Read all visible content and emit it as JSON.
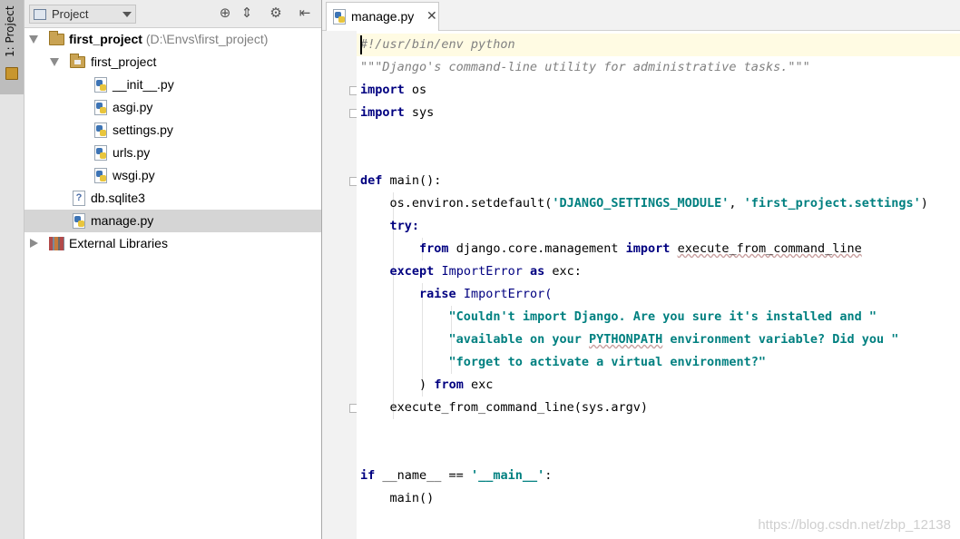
{
  "tool_strip": {
    "project_tab_label": "1: Project"
  },
  "project_panel": {
    "view_selector": "Project",
    "toolbar_icons": [
      "locate-icon",
      "collapse-all-icon",
      "gear-icon",
      "hide-icon"
    ],
    "tree": [
      {
        "label": "first_project",
        "path": "(D:\\Envs\\first_project)",
        "type": "folder",
        "expanded": true
      },
      {
        "label": "first_project",
        "type": "folder",
        "expanded": true
      },
      {
        "label": "__init__.py",
        "type": "python-file"
      },
      {
        "label": "asgi.py",
        "type": "python-file"
      },
      {
        "label": "settings.py",
        "type": "python-file"
      },
      {
        "label": "urls.py",
        "type": "python-file"
      },
      {
        "label": "wsgi.py",
        "type": "python-file"
      },
      {
        "label": "db.sqlite3",
        "type": "unknown-file"
      },
      {
        "label": "manage.py",
        "type": "python-file",
        "selected": true
      },
      {
        "label": "External Libraries",
        "type": "library",
        "expanded": false
      }
    ]
  },
  "editor": {
    "tab": {
      "label": "manage.py",
      "close": "✕"
    },
    "code": {
      "shebang": "#!/usr/bin/env python",
      "docstring": "\"\"\"Django's command-line utility for administrative tasks.\"\"\"",
      "import_kw": "import",
      "os": "os",
      "sys": "sys",
      "def_kw": "def",
      "main_sig": "main():",
      "setdefault_call": "os.environ.setdefault(",
      "settings_key": "'DJANGO_SETTINGS_MODULE'",
      "comma": ", ",
      "settings_val": "'first_project.settings'",
      "close_paren": ")",
      "try_kw": "try:",
      "from_kw": "from",
      "mgmt_module": "django.core.management",
      "execute_name": "execute_from_command_line",
      "except_kw": "except",
      "import_error": "ImportError",
      "as_kw": "as",
      "exc_colon": "exc:",
      "raise_kw": "raise",
      "import_error_call": "ImportError(",
      "msg1": "\"Couldn't import Django. Are you sure it's installed and \"",
      "msg2_a": "\"available on your ",
      "msg2_b": "PYTHONPATH",
      "msg2_c": " environment variable? Did you \"",
      "msg3": "\"forget to activate a virtual environment?\"",
      "paren_close": ")",
      "exc": "exc",
      "exec_call": "execute_from_command_line(sys.argv)",
      "if_kw": "if",
      "name_check": "__name__ == ",
      "main_str": "'__main__'",
      "colon": ":",
      "main_call": "main()"
    }
  },
  "watermark": "https://blog.csdn.net/zbp_12138"
}
